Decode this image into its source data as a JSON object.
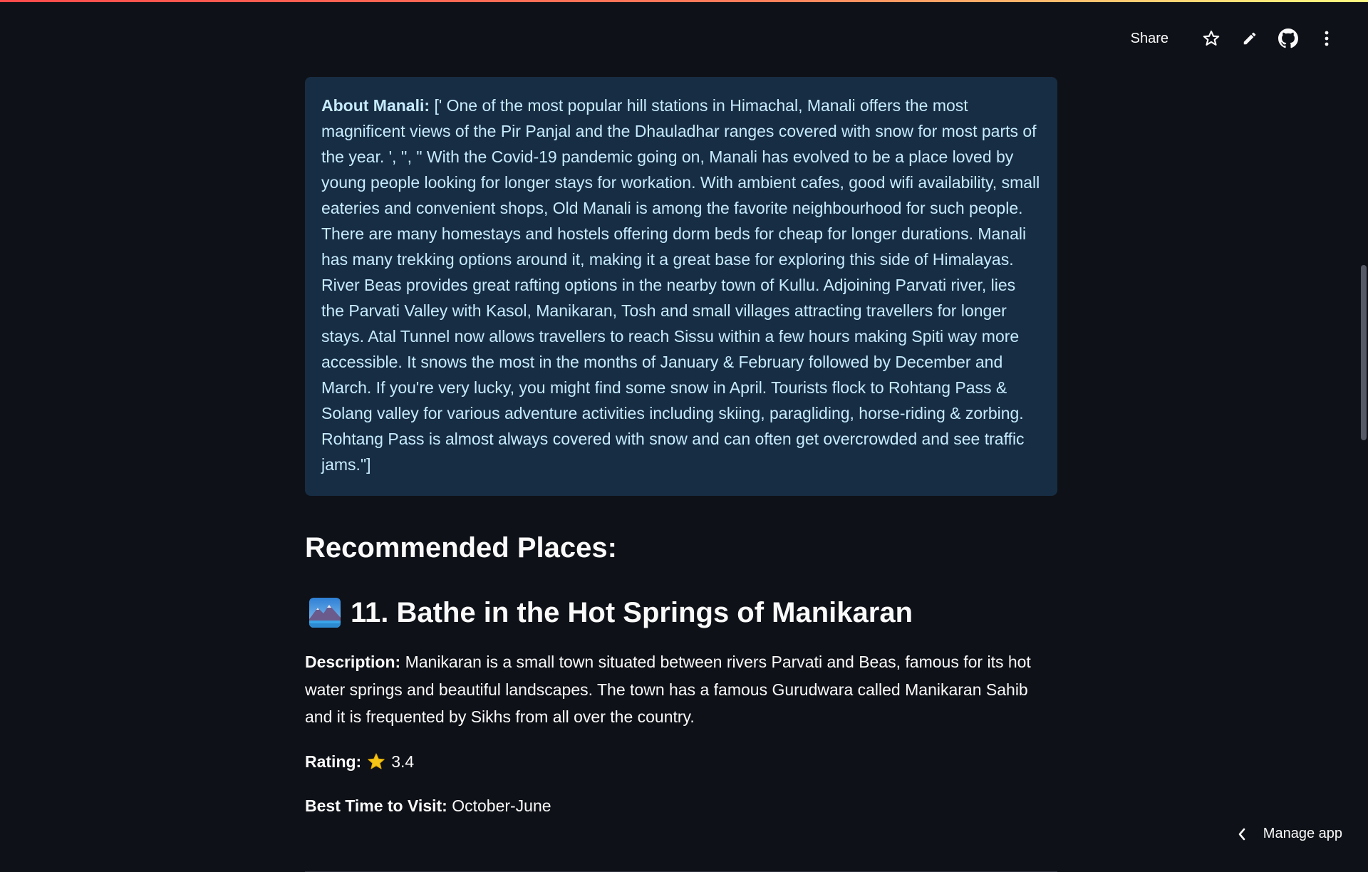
{
  "toolbar": {
    "share_label": "Share",
    "icons": [
      "star-icon",
      "pencil-icon",
      "github-icon",
      "more-vertical-icon"
    ]
  },
  "about": {
    "label": "About Manali:",
    "text": "[' One of the most popular hill stations in Himachal, Manali offers the most magnificent views of the Pir Panjal and the Dhauladhar ranges covered with snow for most parts of the year. ', '', \" With the Covid-19 pandemic going on, Manali has evolved to be a place loved by young people looking for longer stays for workation. With ambient cafes, good wifi availability, small eateries and convenient shops, Old Manali is among the favorite neighbourhood for such people. There are many homestays and hostels offering dorm beds for cheap for longer durations. Manali has many trekking options around it, making it a great base for exploring this side of Himalayas. River Beas provides great rafting options in the nearby town of Kullu. Adjoining Parvati river, lies the Parvati Valley with Kasol, Manikaran, Tosh and small villages attracting travellers for longer stays. Atal Tunnel now allows travellers to reach Sissu within a few hours making Spiti way more accessible. It snows the most in the months of January & February followed by December and March. If you're very lucky, you might find some snow in April. Tourists flock to Rohtang Pass & Solang valley for various adventure activities including skiing, paragliding, horse-riding & zorbing. Rohtang Pass is almost always covered with snow and can often get overcrowded and see traffic jams.\"]"
  },
  "recommended": {
    "heading": "Recommended Places:",
    "place": {
      "title": "11. Bathe in the Hot Springs of Manikaran",
      "description_label": "Description:",
      "description": "Manikaran is a small town situated between rivers Parvati and Beas, famous for its hot water springs and beautiful landscapes. The town has a famous Gurudwara called Manikaran Sahib and it is frequented by Sikhs from all over the country.",
      "rating_label": "Rating:",
      "rating": "3.4",
      "best_time_label": "Best Time to Visit:",
      "best_time": "October-June"
    }
  },
  "footer": {
    "manage_app_label": "Manage app"
  },
  "colors": {
    "background": "#0e1117",
    "info_box": "#172d43",
    "info_text": "#c7ebff",
    "star": "#f5c518"
  }
}
